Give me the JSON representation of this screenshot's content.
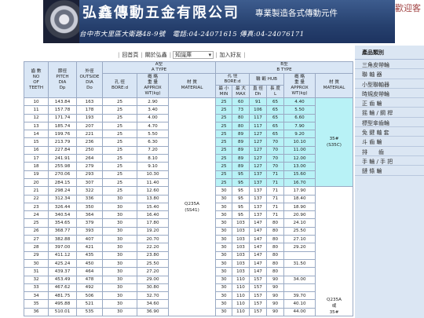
{
  "header": {
    "company_name": "弘鑫傳動五金有限公司",
    "slogan": "專業製造各式傳動元件",
    "address_line": "台中市大里區大衛路48-9號　電話:04-24071615 傳真:04-24076171",
    "welcome": "歡迎客"
  },
  "nav": {
    "home": "回首頁",
    "about": "關於弘鑫",
    "knowledge_select": "知識庫",
    "join": "加入好友"
  },
  "table": {
    "headers": {
      "teeth": "齒 數\nNO\nOF\nTEETH",
      "pitch": "節徑\nPITCH\nDIA\nDp",
      "outside": "外徑\nOUTSIDE\nDIA\nDo",
      "a_type": "A型\nA TYPE",
      "b_type": "B型\nB TYPE",
      "bore": "孔 徑\nBORE:d",
      "weight": "概 略\n重 量\nAPPROX\nWT(kg)",
      "material": "材 質\nMATERIAL",
      "bore_b": "孔 徑\nBORE:d",
      "hub": "輪 轂\nHUB",
      "bore_min": "最 小\nMIN",
      "bore_max": "最 大\nMAX",
      "hub_dia": "直 徑\nDh",
      "hub_len": "長 度\nL"
    },
    "material_a": "Q235A\n(SS41)",
    "material_b1": "35#\n(S35C)",
    "material_b2": "Q235A\n或\n35#",
    "rows": [
      {
        "teeth": "10",
        "pitch": "143.84",
        "od": "163",
        "bore": "25",
        "wt": "2.90",
        "bmin": "25",
        "bmax": "60",
        "dh": "91",
        "l": "65",
        "bwt": "4.40"
      },
      {
        "teeth": "11",
        "pitch": "157.78",
        "od": "178",
        "bore": "25",
        "wt": "3.40",
        "bmin": "25",
        "bmax": "73",
        "dh": "106",
        "l": "65",
        "bwt": "5.50"
      },
      {
        "teeth": "12",
        "pitch": "171.74",
        "od": "193",
        "bore": "25",
        "wt": "4.00",
        "bmin": "25",
        "bmax": "80",
        "dh": "117",
        "l": "65",
        "bwt": "6.60"
      },
      {
        "teeth": "13",
        "pitch": "185.74",
        "od": "207",
        "bore": "25",
        "wt": "4.70",
        "bmin": "25",
        "bmax": "80",
        "dh": "117",
        "l": "65",
        "bwt": "7.90"
      },
      {
        "teeth": "14",
        "pitch": "199.76",
        "od": "221",
        "bore": "25",
        "wt": "5.50",
        "bmin": "25",
        "bmax": "89",
        "dh": "127",
        "l": "65",
        "bwt": "9.20"
      },
      {
        "teeth": "15",
        "pitch": "213.79",
        "od": "236",
        "bore": "25",
        "wt": "6.30",
        "bmin": "25",
        "bmax": "89",
        "dh": "127",
        "l": "70",
        "bwt": "10.10"
      },
      {
        "teeth": "16",
        "pitch": "227.84",
        "od": "250",
        "bore": "25",
        "wt": "7.20",
        "bmin": "25",
        "bmax": "89",
        "dh": "127",
        "l": "70",
        "bwt": "11.00"
      },
      {
        "teeth": "17",
        "pitch": "241.91",
        "od": "264",
        "bore": "25",
        "wt": "8.10",
        "bmin": "25",
        "bmax": "89",
        "dh": "127",
        "l": "70",
        "bwt": "12.00"
      },
      {
        "teeth": "18",
        "pitch": "255.98",
        "od": "279",
        "bore": "25",
        "wt": "9.10",
        "bmin": "25",
        "bmax": "89",
        "dh": "127",
        "l": "70",
        "bwt": "13.00"
      },
      {
        "teeth": "19",
        "pitch": "270.06",
        "od": "293",
        "bore": "25",
        "wt": "10.30",
        "bmin": "25",
        "bmax": "95",
        "dh": "137",
        "l": "71",
        "bwt": "15.60"
      },
      {
        "teeth": "20",
        "pitch": "284.15",
        "od": "307",
        "bore": "25",
        "wt": "11.40",
        "bmin": "25",
        "bmax": "95",
        "dh": "137",
        "l": "71",
        "bwt": "16.70"
      },
      {
        "teeth": "21",
        "pitch": "298.24",
        "od": "322",
        "bore": "25",
        "wt": "12.60",
        "bmin": "30",
        "bmax": "95",
        "dh": "137",
        "l": "71",
        "bwt": "17.90"
      },
      {
        "teeth": "22",
        "pitch": "312.34",
        "od": "336",
        "bore": "30",
        "wt": "13.80",
        "bmin": "30",
        "bmax": "95",
        "dh": "137",
        "l": "71",
        "bwt": "18.40"
      },
      {
        "teeth": "23",
        "pitch": "326.44",
        "od": "350",
        "bore": "30",
        "wt": "15.40",
        "bmin": "30",
        "bmax": "95",
        "dh": "137",
        "l": "71",
        "bwt": "18.90"
      },
      {
        "teeth": "24",
        "pitch": "340.54",
        "od": "364",
        "bore": "30",
        "wt": "16.40",
        "bmin": "30",
        "bmax": "95",
        "dh": "137",
        "l": "71",
        "bwt": "20.90"
      },
      {
        "teeth": "25",
        "pitch": "354.65",
        "od": "379",
        "bore": "30",
        "wt": "17.80",
        "bmin": "30",
        "bmax": "103",
        "dh": "147",
        "l": "80",
        "bwt": "24.10"
      },
      {
        "teeth": "26",
        "pitch": "368.77",
        "od": "393",
        "bore": "30",
        "wt": "19.20",
        "bmin": "30",
        "bmax": "103",
        "dh": "147",
        "l": "80",
        "bwt": "25.50"
      },
      {
        "teeth": "27",
        "pitch": "382.88",
        "od": "407",
        "bore": "30",
        "wt": "20.70",
        "bmin": "30",
        "bmax": "103",
        "dh": "147",
        "l": "80",
        "bwt": "27.10"
      },
      {
        "teeth": "28",
        "pitch": "397.00",
        "od": "421",
        "bore": "30",
        "wt": "22.20",
        "bmin": "30",
        "bmax": "103",
        "dh": "147",
        "l": "80",
        "bwt": "29.20"
      },
      {
        "teeth": "29",
        "pitch": "411.12",
        "od": "435",
        "bore": "30",
        "wt": "23.80",
        "bmin": "30",
        "bmax": "103",
        "dh": "147",
        "l": "80",
        "bwt": ""
      },
      {
        "teeth": "30",
        "pitch": "425.24",
        "od": "450",
        "bore": "30",
        "wt": "25.50",
        "bmin": "30",
        "bmax": "103",
        "dh": "147",
        "l": "80",
        "bwt": "31.50"
      },
      {
        "teeth": "31",
        "pitch": "439.37",
        "od": "464",
        "bore": "30",
        "wt": "27.20",
        "bmin": "30",
        "bmax": "103",
        "dh": "147",
        "l": "80",
        "bwt": ""
      },
      {
        "teeth": "32",
        "pitch": "453.49",
        "od": "478",
        "bore": "30",
        "wt": "29.00",
        "bmin": "30",
        "bmax": "110",
        "dh": "157",
        "l": "90",
        "bwt": "34.00"
      },
      {
        "teeth": "33",
        "pitch": "467.62",
        "od": "492",
        "bore": "30",
        "wt": "30.80",
        "bmin": "30",
        "bmax": "110",
        "dh": "157",
        "l": "90",
        "bwt": ""
      },
      {
        "teeth": "34",
        "pitch": "481.75",
        "od": "506",
        "bore": "30",
        "wt": "32.70",
        "bmin": "30",
        "bmax": "110",
        "dh": "157",
        "l": "90",
        "bwt": "39.70"
      },
      {
        "teeth": "35",
        "pitch": "495.88",
        "od": "521",
        "bore": "30",
        "wt": "34.60",
        "bmin": "30",
        "bmax": "110",
        "dh": "157",
        "l": "90",
        "bwt": "40.10"
      },
      {
        "teeth": "36",
        "pitch": "510.01",
        "od": "535",
        "bore": "30",
        "wt": "36.90",
        "bmin": "30",
        "bmax": "110",
        "dh": "157",
        "l": "90",
        "bwt": "44.00"
      }
    ]
  },
  "sidebar": {
    "title": "產品類別",
    "items": [
      "三角皮帶輪",
      "聯 軸 器",
      "小型聯軸器",
      "時規皮帶輪",
      "正 齒 輪",
      "摇 輪 / 鋼 桿",
      "標型傘齒輪",
      "免 鍵 軸 套",
      "斗 齒 輪",
      "排　　齒",
      "手 輪 / 手 把",
      "鏈 條 輪"
    ]
  },
  "colors": {
    "banner": "#26406e",
    "header_bg": "#d9e6f5",
    "b_type_bg": "#b8f2f6",
    "sidebar_bg": "#dbe6f3"
  }
}
